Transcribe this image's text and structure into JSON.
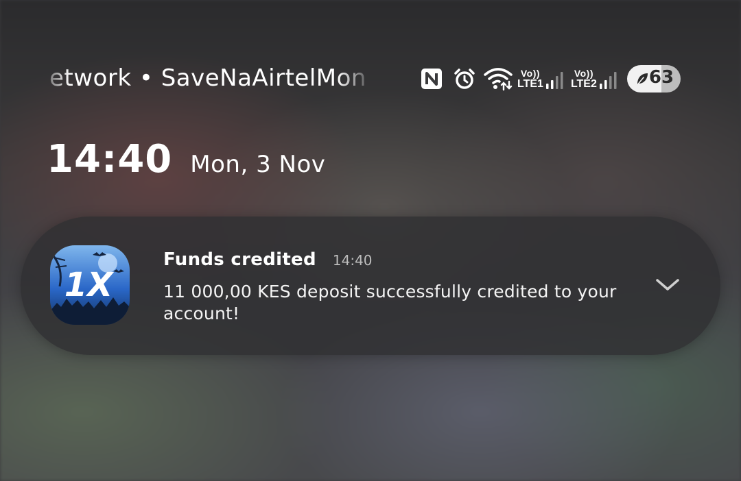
{
  "status_bar": {
    "carrier_text": "etwork • SaveNaAirtelMon",
    "icons": [
      "nfc-icon",
      "alarm-icon",
      "wifi-icon",
      "signal-icon",
      "signal-icon",
      "leaf-icon"
    ],
    "sim1": {
      "volte_label": "Vo))",
      "network_label": "LTE1"
    },
    "sim2": {
      "volte_label": "Vo))",
      "network_label": "LTE2"
    },
    "battery": {
      "level": "63"
    }
  },
  "lock_screen": {
    "time": "14:40",
    "date": "Mon, 3 Nov"
  },
  "notification": {
    "app_icon": {
      "text": "1X",
      "colors": {
        "primary": "#2a67c8",
        "dark": "#11305e",
        "light": "#7fb6ec"
      }
    },
    "title": "Funds credited",
    "time": "14:40",
    "body": "11 000,00 KES deposit successfully credited to your account!",
    "expand_icon": "chevron-down-icon"
  },
  "colors": {
    "text_primary": "#ffffff",
    "text_secondary": "#bdbdbd",
    "notification_bg": "#303032",
    "battery_bg": "#f1f1f1"
  }
}
